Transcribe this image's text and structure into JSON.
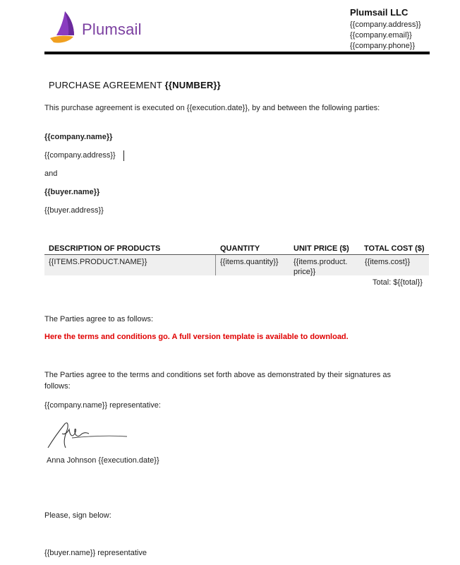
{
  "header": {
    "logo_text": "Plumsail",
    "company_name": "Plumsail LLC",
    "company_address": "{{company.address}}",
    "company_email": "{{company.email}}",
    "company_phone": "{{company.phone}}"
  },
  "title": {
    "prefix": "PURCHASE AGREEMENT",
    "number": "{{NUMBER}}"
  },
  "intro": "This purchase agreement is executed on {{execution.date}}, by and between the following parties:",
  "parties": {
    "company_name": "{{company.name}}",
    "company_address": "{{company.address}}",
    "and": "and",
    "buyer_name": "{{buyer.name}}",
    "buyer_address": "{{buyer.address}}"
  },
  "table": {
    "columns": [
      "DESCRIPTION OF PRODUCTS",
      "QUANTITY",
      "UNIT PRICE ($)",
      "TOTAL COST ($)"
    ],
    "row": {
      "description": "{{ITEMS.PRODUCT.NAME}}",
      "quantity": "{{items.quantity}}",
      "unit_price_line1": "{{items.product.",
      "unit_price_line2": "price}}",
      "total_cost": "{{items.cost}}"
    },
    "total": "Total: ${{total}}"
  },
  "agree_intro": "The Parties agree to as follows:",
  "terms_note": "Here the terms and conditions go. A full version template is available to download.",
  "agree_terms_line1": "The Parties agree to the terms and conditions set forth above as demonstrated by their signatures as",
  "agree_terms_line2": "follows:",
  "company_rep": "{{company.name}} representative:",
  "signer": "Anna Johnson {{execution.date}}",
  "sign_below": "Please, sign below:",
  "buyer_rep": "{{buyer.name}} representative",
  "colors": {
    "logo_purple": "#7b3fa0",
    "logo_orange": "#f0a020",
    "terms_red": "#e00000",
    "rule": "#000000"
  }
}
